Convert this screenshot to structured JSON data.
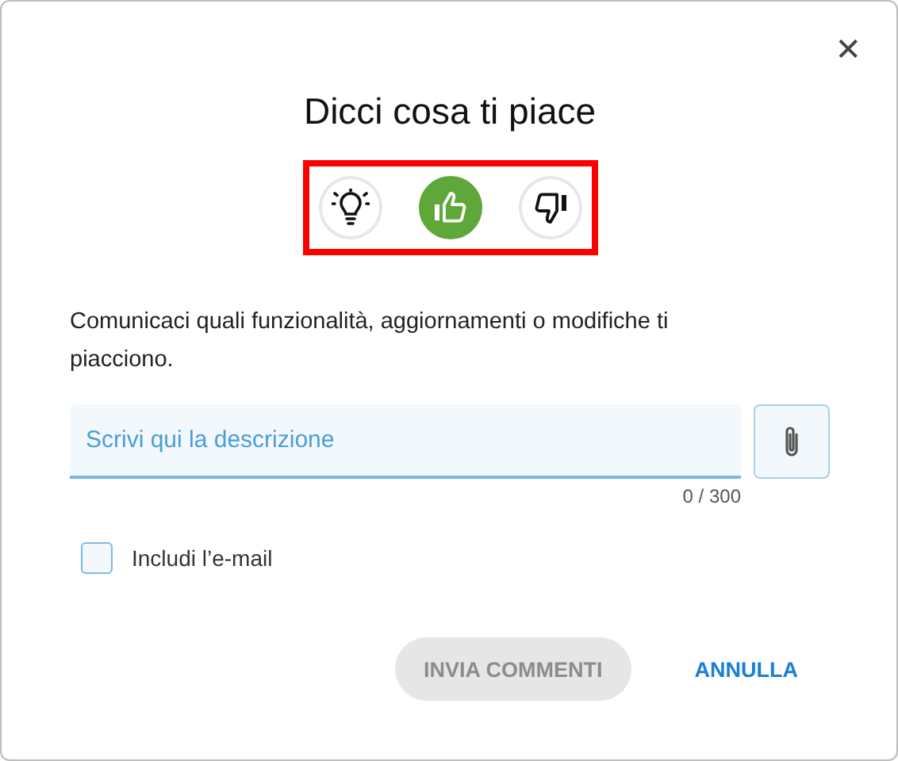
{
  "dialog": {
    "title": "Dicci cosa ti piace",
    "close_label": "✕"
  },
  "feedback_types": [
    {
      "kind": "idea",
      "selected": false
    },
    {
      "kind": "like",
      "selected": true
    },
    {
      "kind": "dislike",
      "selected": false
    }
  ],
  "description": "Comunicaci quali funzionalità, aggiornamenti o modifiche ti piacciono.",
  "comment_field": {
    "placeholder": "Scrivi qui la descrizione",
    "counter": "0 / 300"
  },
  "include_email": {
    "label": "Includi l’e-mail",
    "checked": false
  },
  "buttons": [
    {
      "label": "INVIA COMMENTI",
      "kind": "submit",
      "disabled": true
    },
    {
      "label": "ANNULLA",
      "kind": "cancel",
      "disabled": false
    }
  ]
}
